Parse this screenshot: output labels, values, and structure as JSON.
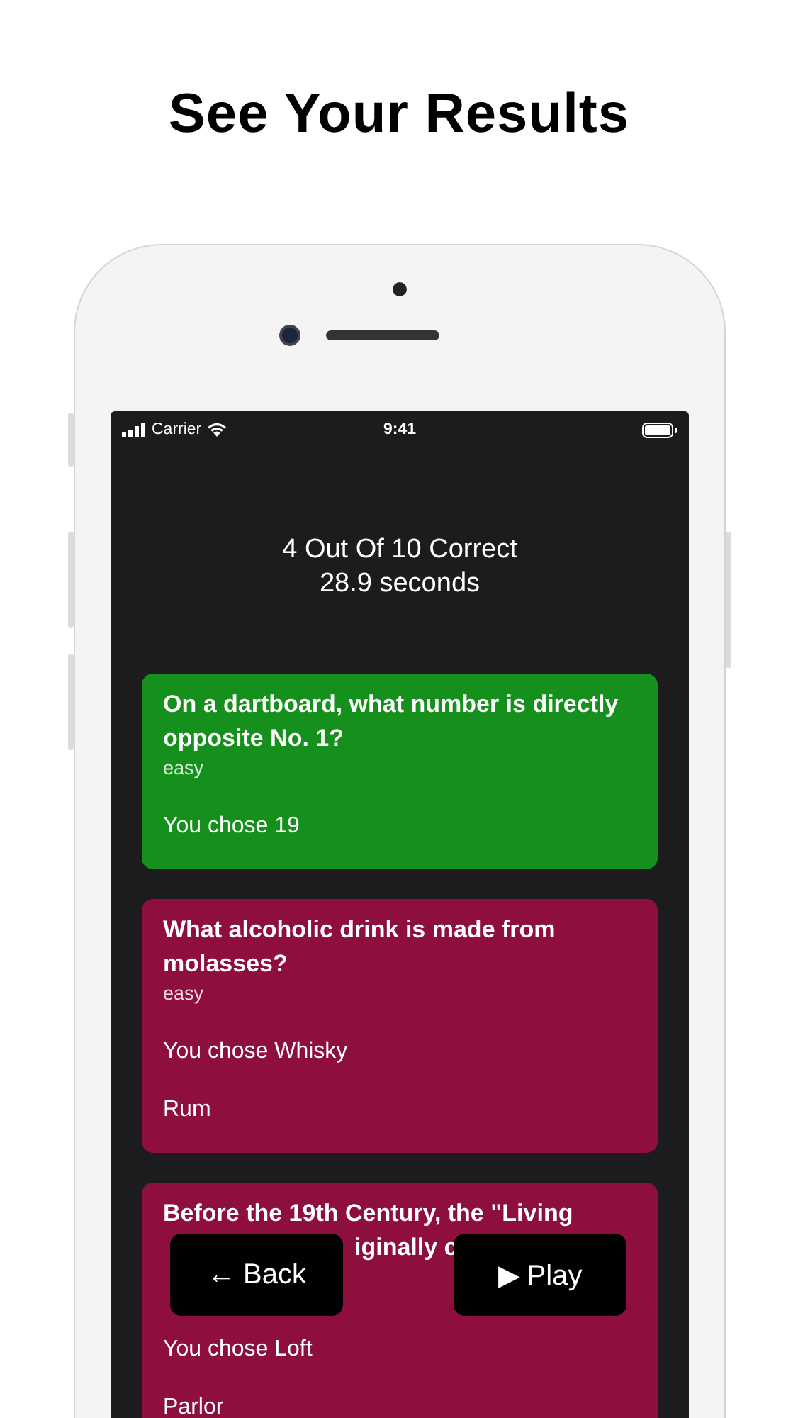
{
  "heading": "See Your Results",
  "status_bar": {
    "carrier": "Carrier",
    "time": "9:41"
  },
  "summary": {
    "score": "4 Out Of 10 Correct",
    "time": "28.9 seconds"
  },
  "results": [
    {
      "kind": "correct",
      "question": "On a dartboard, what number is directly opposite No. 1?",
      "difficulty": "easy",
      "chosen": "You chose 19"
    },
    {
      "kind": "incorrect",
      "question": "What alcoholic drink is made from molasses?",
      "difficulty": "easy",
      "chosen": "You chose Whisky",
      "answer": "Rum"
    },
    {
      "kind": "incorrect",
      "question": "Before the 19th Century, the \"Living",
      "question_fragment": "iginally c",
      "chosen": "You chose Loft",
      "answer": "Parlor"
    }
  ],
  "buttons": [
    "← Back",
    "▶ Play"
  ]
}
